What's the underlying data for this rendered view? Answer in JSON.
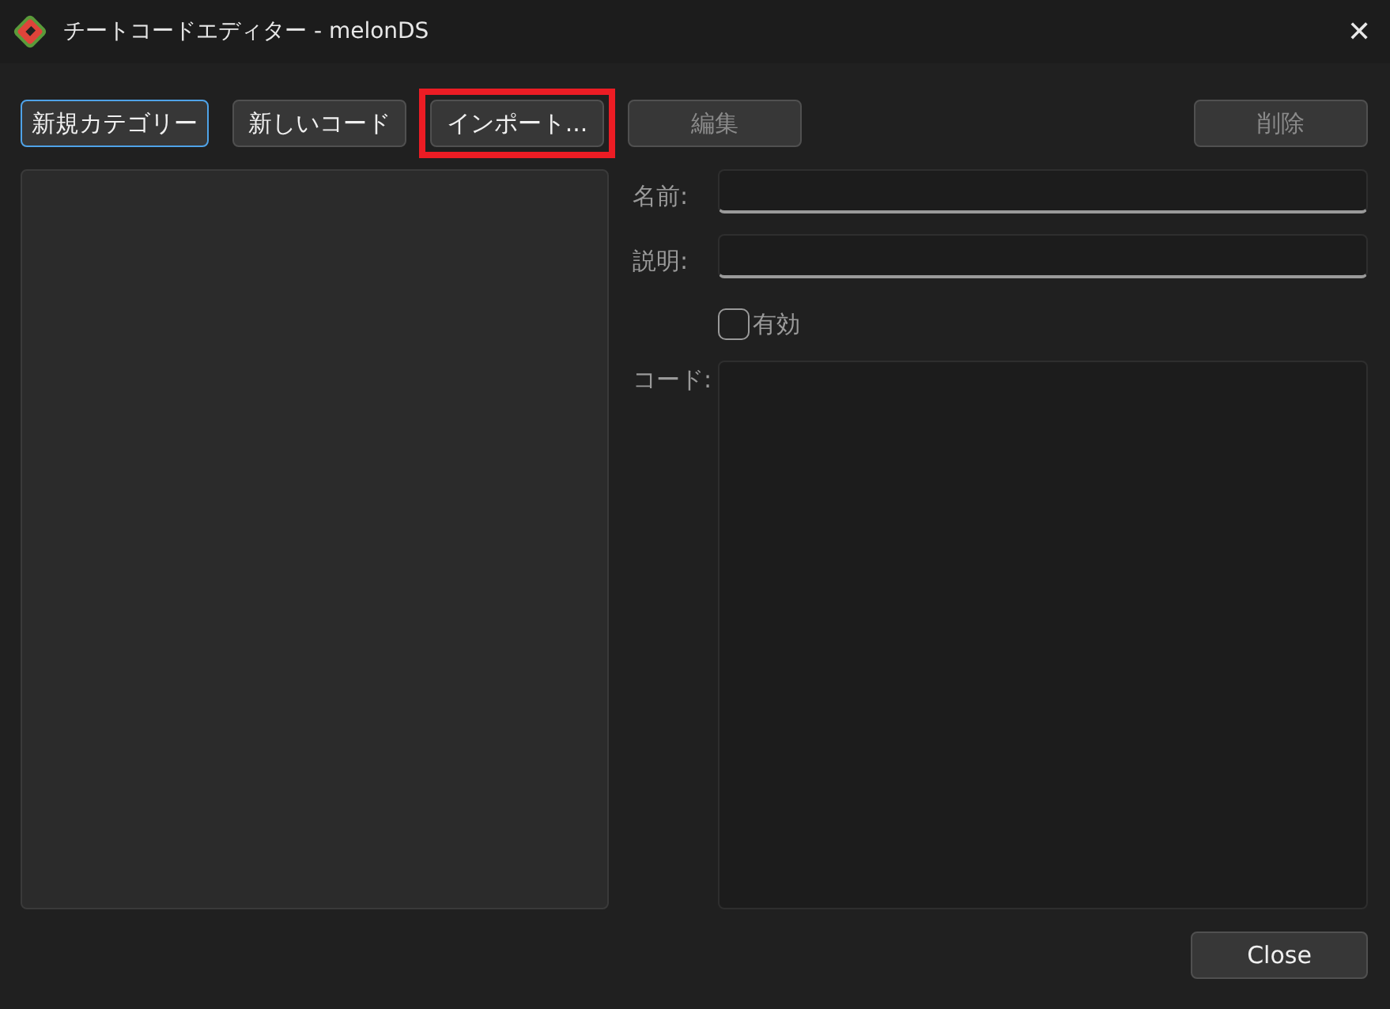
{
  "window": {
    "title": "チートコードエディター - melonDS",
    "close": "✕"
  },
  "toolbar": {
    "left": [
      {
        "label": "新規カテゴリー",
        "focused": true,
        "disabled": false,
        "highlighted": false
      },
      {
        "label": "新しいコード",
        "focused": false,
        "disabled": false,
        "highlighted": false
      },
      {
        "label": "インポート...",
        "focused": false,
        "disabled": false,
        "highlighted": true
      },
      {
        "label": "編集",
        "focused": false,
        "disabled": true,
        "highlighted": false
      }
    ],
    "right": [
      {
        "label": "削除",
        "focused": false,
        "disabled": true,
        "highlighted": false
      }
    ]
  },
  "form": {
    "name": {
      "label": "名前:",
      "disabled": true
    },
    "description": {
      "label": "説明:",
      "disabled": true
    },
    "enabled": {
      "label": "有効",
      "checked": false,
      "disabled": true
    },
    "code": {
      "label": "コード:",
      "disabled": true
    }
  },
  "buttons": [
    "Close"
  ]
}
